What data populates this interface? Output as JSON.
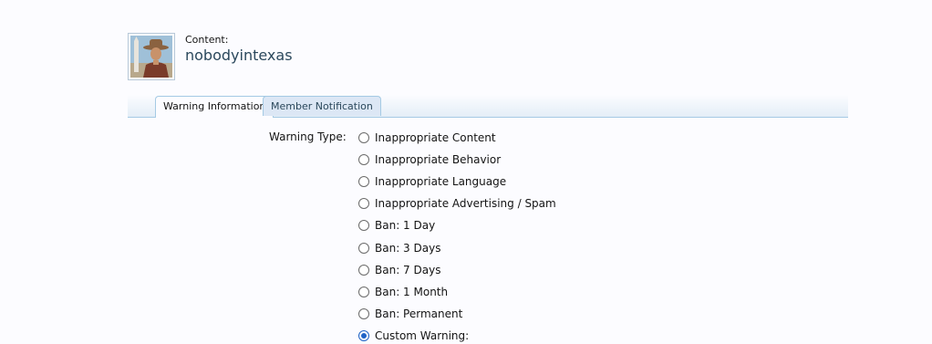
{
  "content": {
    "label": "Content:",
    "username": "nobodyintexas",
    "avatar_icon": "avatar-cowboy"
  },
  "tabs": [
    {
      "label": "Warning Information",
      "active": true
    },
    {
      "label": "Member Notification",
      "active": false
    }
  ],
  "warning": {
    "label": "Warning Type:",
    "options": [
      {
        "label": "Inappropriate Content",
        "checked": false
      },
      {
        "label": "Inappropriate Behavior",
        "checked": false
      },
      {
        "label": "Inappropriate Language",
        "checked": false
      },
      {
        "label": "Inappropriate Advertising / Spam",
        "checked": false
      },
      {
        "label": "Ban: 1 Day",
        "checked": false
      },
      {
        "label": "Ban: 3 Days",
        "checked": false
      },
      {
        "label": "Ban: 7 Days",
        "checked": false
      },
      {
        "label": "Ban: 1 Month",
        "checked": false
      },
      {
        "label": "Ban: Permanent",
        "checked": false
      },
      {
        "label": "Custom Warning:",
        "checked": true
      }
    ]
  },
  "colors": {
    "accent": "#1f63c6",
    "username": "#2b485c",
    "tab_border": "#a5cae4"
  }
}
